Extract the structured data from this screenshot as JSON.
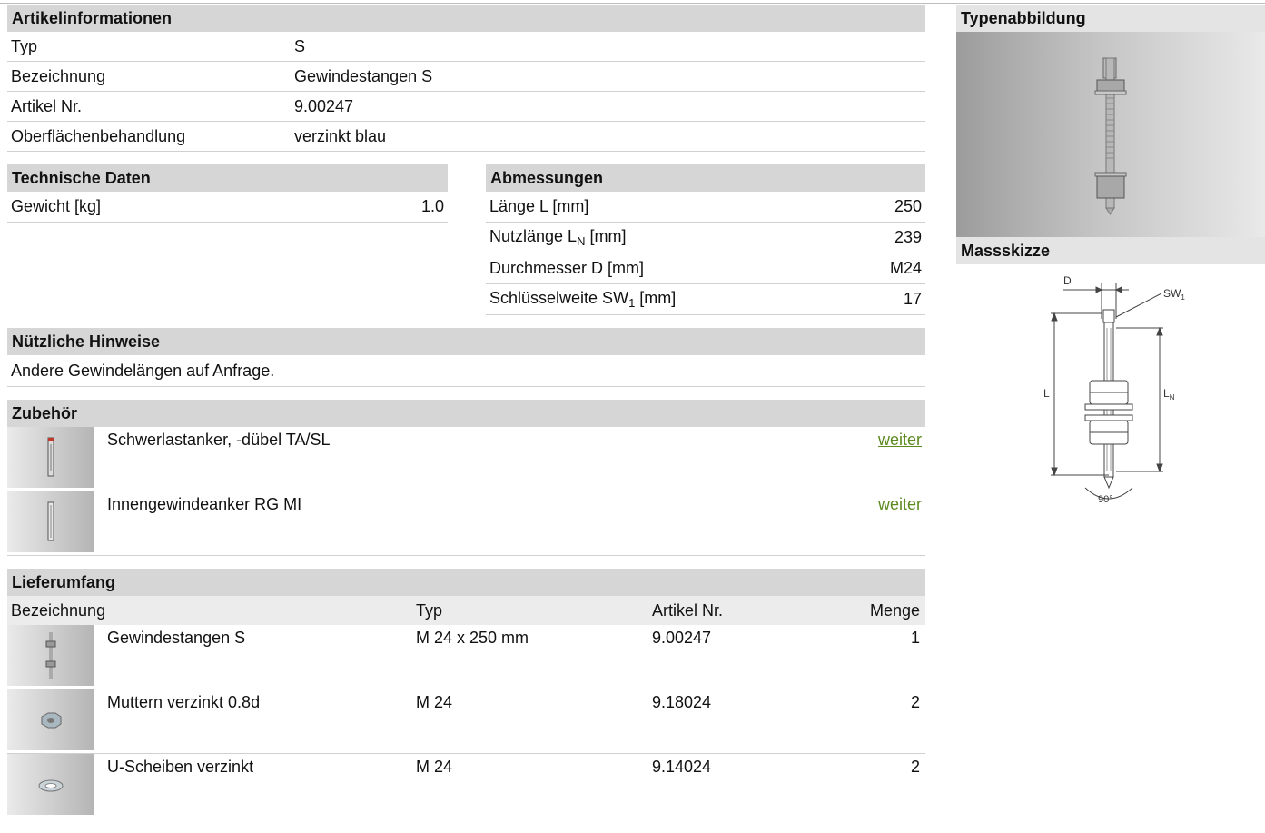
{
  "article_info": {
    "title": "Artikelinformationen",
    "rows": [
      {
        "label": "Typ",
        "value": "S"
      },
      {
        "label": "Bezeichnung",
        "value": "Gewindestangen S"
      },
      {
        "label": "Artikel Nr.",
        "value": "9.00247"
      },
      {
        "label": "Oberflächenbehandlung",
        "value": "verzinkt blau"
      }
    ]
  },
  "tech_data": {
    "title": "Technische Daten",
    "rows": [
      {
        "label": "Gewicht [kg]",
        "value": "1.0"
      }
    ]
  },
  "dimensions": {
    "title": "Abmessungen",
    "rows": [
      {
        "label": "Länge L [mm]",
        "value": "250"
      },
      {
        "label_pre": "Nutzlänge L",
        "label_sub": "N",
        "label_post": " [mm]",
        "value": "239"
      },
      {
        "label": "Durchmesser D [mm]",
        "value": "M24"
      },
      {
        "label_pre": "Schlüsselweite SW",
        "label_sub": "1",
        "label_post": " [mm]",
        "value": "17"
      }
    ]
  },
  "hints": {
    "title": "Nützliche Hinweise",
    "text": "Andere Gewindelängen auf Anfrage."
  },
  "accessories": {
    "title": "Zubehör",
    "items": [
      {
        "name": "Schwerlastanker, -dübel TA/SL",
        "link": "weiter"
      },
      {
        "name": "Innengewindeanker RG MI",
        "link": "weiter"
      }
    ]
  },
  "delivery": {
    "title": "Lieferumfang",
    "columns": [
      "Bezeichnung",
      "Typ",
      "Artikel Nr.",
      "Menge"
    ],
    "rows": [
      {
        "name": "Gewindestangen S",
        "type": "M 24 x 250 mm",
        "article": "9.00247",
        "qty": "1"
      },
      {
        "name": "Muttern verzinkt 0.8d",
        "type": "M 24",
        "article": "9.18024",
        "qty": "2"
      },
      {
        "name": "U-Scheiben verzinkt",
        "type": "M 24",
        "article": "9.14024",
        "qty": "2"
      }
    ]
  },
  "side": {
    "image_title": "Typenabbildung",
    "sketch_title": "Massskizze",
    "sketch_labels": {
      "d": "D",
      "sw": "SW",
      "sw_sub": "1",
      "l": "L",
      "ln": "L",
      "ln_sub": "N",
      "angle": "90°"
    }
  },
  "colors": {
    "link": "#5c8a1e",
    "header_bg": "#d6d6d6"
  }
}
